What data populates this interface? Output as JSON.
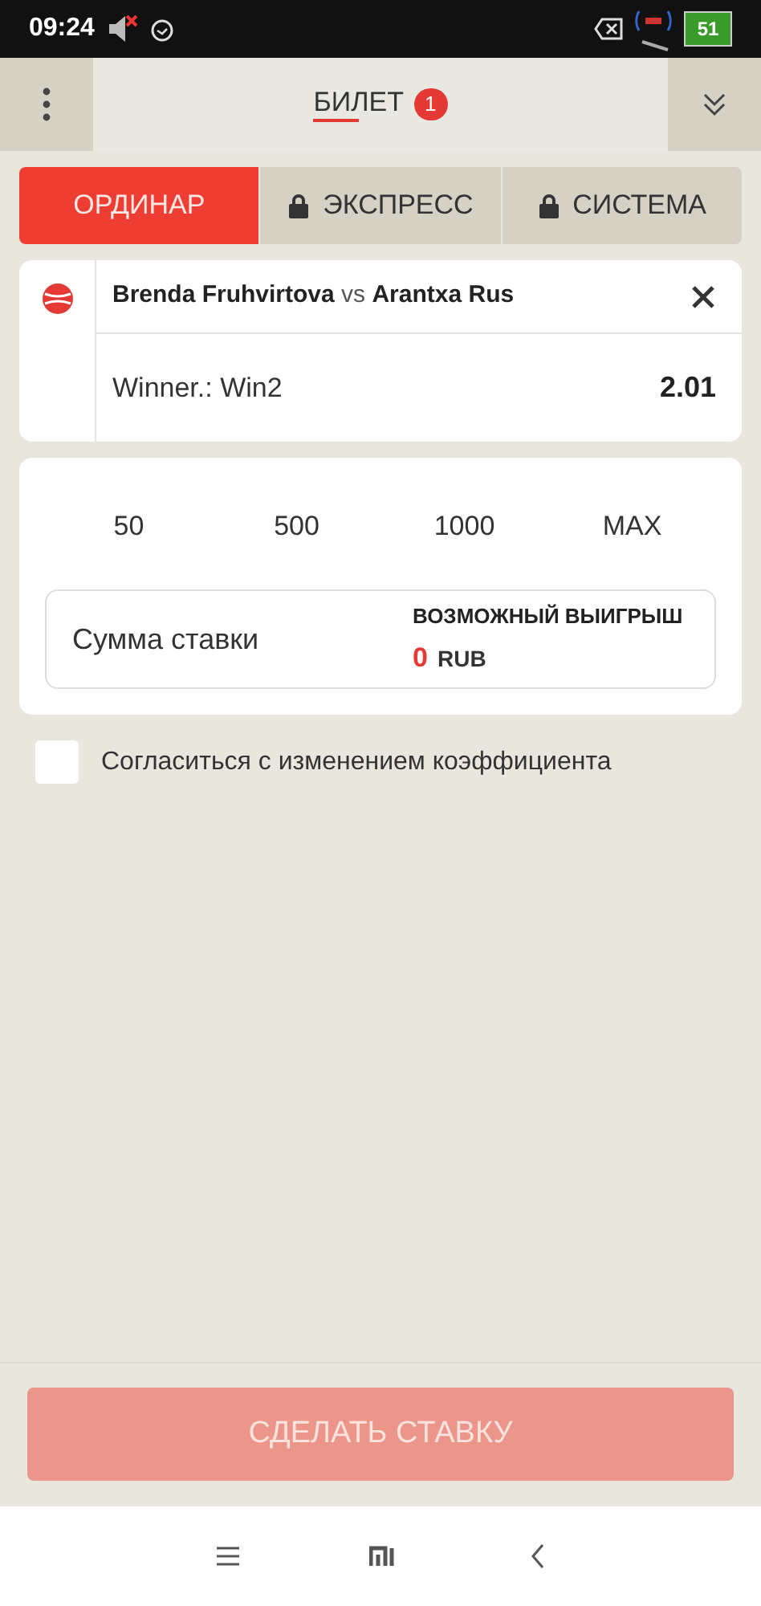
{
  "status_bar": {
    "time": "09:24",
    "battery": "51"
  },
  "header": {
    "title": "БИЛЕТ",
    "badge": "1"
  },
  "bet_tabs": [
    {
      "label": "ОРДИНАР",
      "selected": true,
      "locked": false
    },
    {
      "label": "ЭКСПРЕСС",
      "selected": false,
      "locked": true
    },
    {
      "label": "СИСТЕМА",
      "selected": false,
      "locked": true
    }
  ],
  "bet": {
    "team1": "Brenda Fruhvirtova",
    "vs": "vs",
    "team2": "Arantxa Rus",
    "market": "Winner.: Win2",
    "odds": "2.01"
  },
  "quick_amounts": [
    "50",
    "500",
    "1000",
    "MAX"
  ],
  "stake": {
    "placeholder": "Сумма ставки",
    "win_label": "ВОЗМОЖНЫЙ ВЫИГРЫШ",
    "win_amount": "0",
    "currency": "RUB"
  },
  "accept_changes": {
    "label": "Согласиться с изменением коэффициента",
    "checked": false
  },
  "submit": {
    "label": "СДЕЛАТЬ СТАВКУ",
    "disabled": true
  }
}
